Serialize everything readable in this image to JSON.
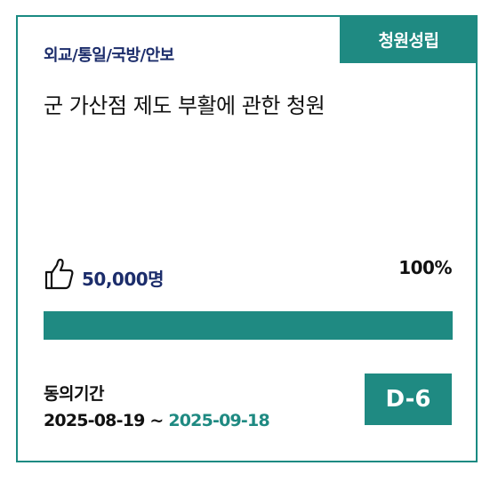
{
  "card": {
    "status_badge": "청원성립",
    "category": "외교/통일/국방/안보",
    "title": "군 가산점 제도 부활에 관한 청원",
    "agree_count": "50,000명",
    "progress_text": "100%",
    "progress_fraction": 1.0,
    "period_label": "동의기간",
    "start_date": "2025-08-19",
    "date_separator": "~",
    "end_date": "2025-09-18",
    "d_day": "D-6",
    "icon": "thumbs-up-icon",
    "colors": {
      "accent": "#1f8a82",
      "navy": "#1c2d6b"
    }
  }
}
